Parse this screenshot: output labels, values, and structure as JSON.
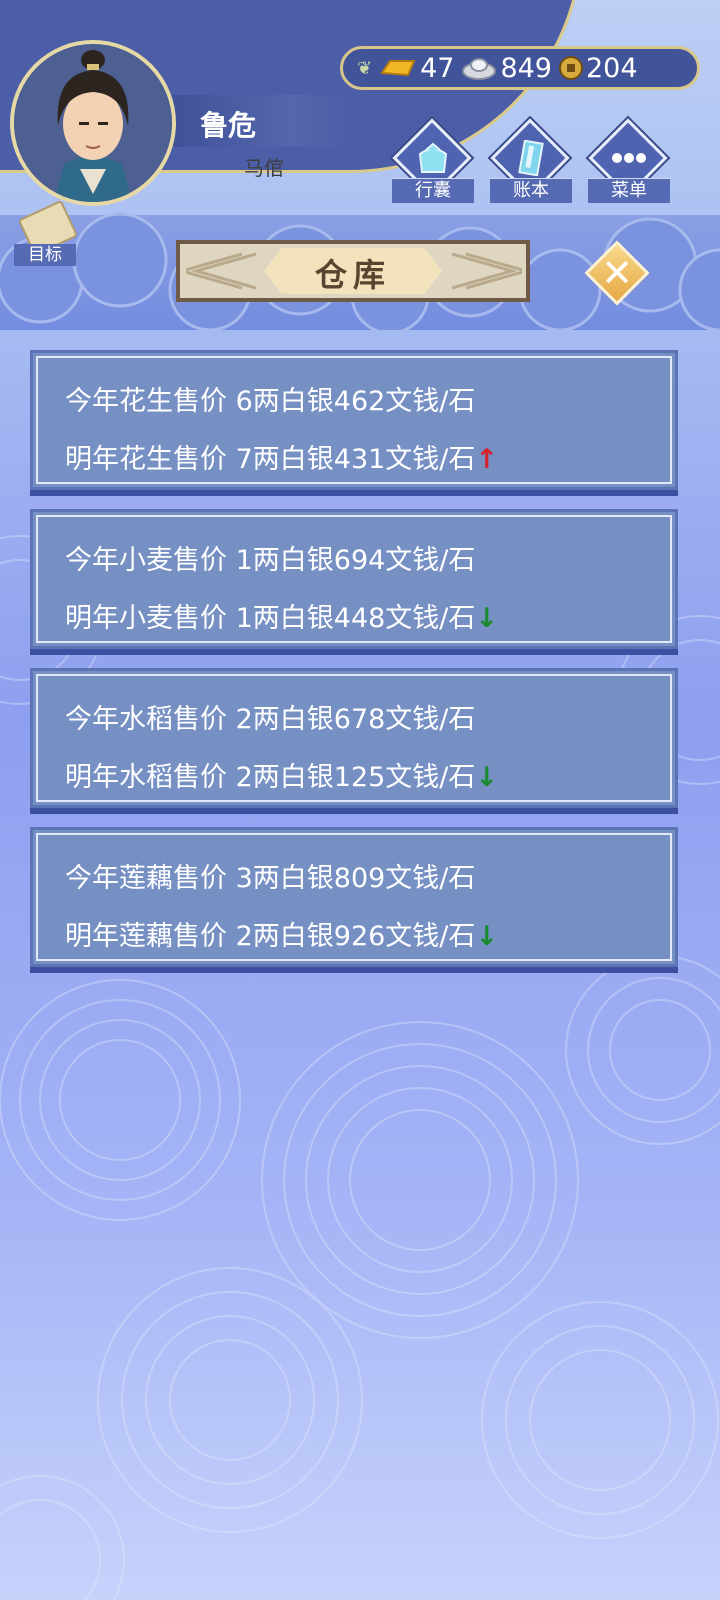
{
  "player": {
    "name": "鲁危",
    "title": "马倌"
  },
  "currency": {
    "gold": "47",
    "silver": "849",
    "coin": "204"
  },
  "buttons": {
    "bag": "行囊",
    "ledger": "账本",
    "menu": "菜单",
    "goal": "目标"
  },
  "panel": {
    "title": "仓库",
    "close_icon": "close-icon"
  },
  "prices": [
    {
      "this_year": "今年花生售价 6两白银462文钱/石",
      "next_year": "明年花生售价 7两白银431文钱/石",
      "trend": "↑",
      "trend_dir": "up"
    },
    {
      "this_year": "今年小麦售价 1两白银694文钱/石",
      "next_year": "明年小麦售价 1两白银448文钱/石",
      "trend": "↓",
      "trend_dir": "down"
    },
    {
      "this_year": "今年水稻售价 2两白银678文钱/石",
      "next_year": "明年水稻售价 2两白银125文钱/石",
      "trend": "↓",
      "trend_dir": "down"
    },
    {
      "this_year": "今年莲藕售价 3两白银809文钱/石",
      "next_year": "明年莲藕售价 2两白银926文钱/石",
      "trend": "↓",
      "trend_dir": "down"
    }
  ],
  "colors": {
    "trend_up": "#d5232c",
    "trend_down": "#1b8a2f",
    "card_bg": "#7690c4"
  }
}
